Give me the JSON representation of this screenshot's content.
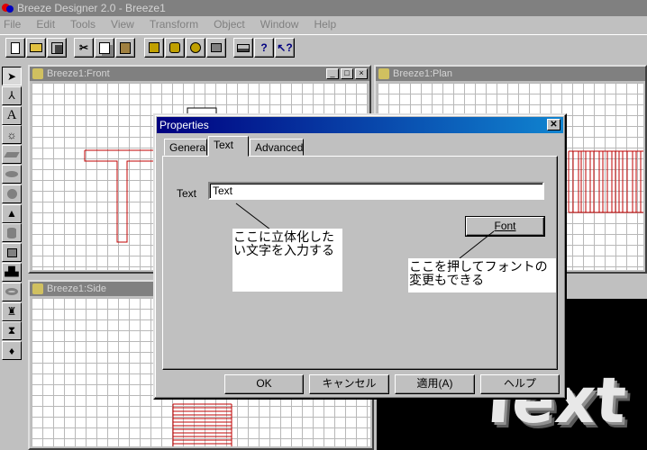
{
  "app": {
    "title": "Breeze Designer 2.0 - Breeze1"
  },
  "menu": [
    "File",
    "Edit",
    "Tools",
    "View",
    "Transform",
    "Object",
    "Window",
    "Help"
  ],
  "toolbar_icons": [
    "new-icon",
    "open-icon",
    "save-icon",
    "cut-icon",
    "copy-icon",
    "paste-icon",
    "object-icon",
    "object-edit-icon",
    "object-add-icon",
    "object-delete-icon",
    "print-icon",
    "help-icon",
    "context-help-icon"
  ],
  "left_tools": [
    "arrow-icon",
    "node-edit-icon",
    "text-icon",
    "light-icon",
    "plane-icon",
    "disc-icon",
    "sphere-icon",
    "cone-icon",
    "cylinder-icon",
    "box-icon",
    "blob-icon",
    "torus-icon",
    "lathe-icon",
    "sweep-icon",
    "special-icon"
  ],
  "windows": {
    "front": {
      "title": "Breeze1:Front"
    },
    "plan": {
      "title": "Breeze1:Plan"
    },
    "side": {
      "title": "Breeze1:Side"
    }
  },
  "dialog": {
    "title": "Properties",
    "tabs": [
      "General",
      "Text",
      "Advanced"
    ],
    "active_tab": "Text",
    "text_label": "Text",
    "text_value": "Text",
    "font_button": "Font",
    "ok_button": "OK",
    "cancel_button": "キャンセル",
    "apply_button": "適用(A)",
    "help_button": "ヘルプ"
  },
  "callouts": {
    "input_note": "ここに立体化したい文字を入力する",
    "font_note": "ここを押してフォントの変更もできる"
  },
  "render_text": "Text",
  "colors": {
    "caption_active": "#000080",
    "caption_inactive": "#808080",
    "wire": "#c00000"
  }
}
